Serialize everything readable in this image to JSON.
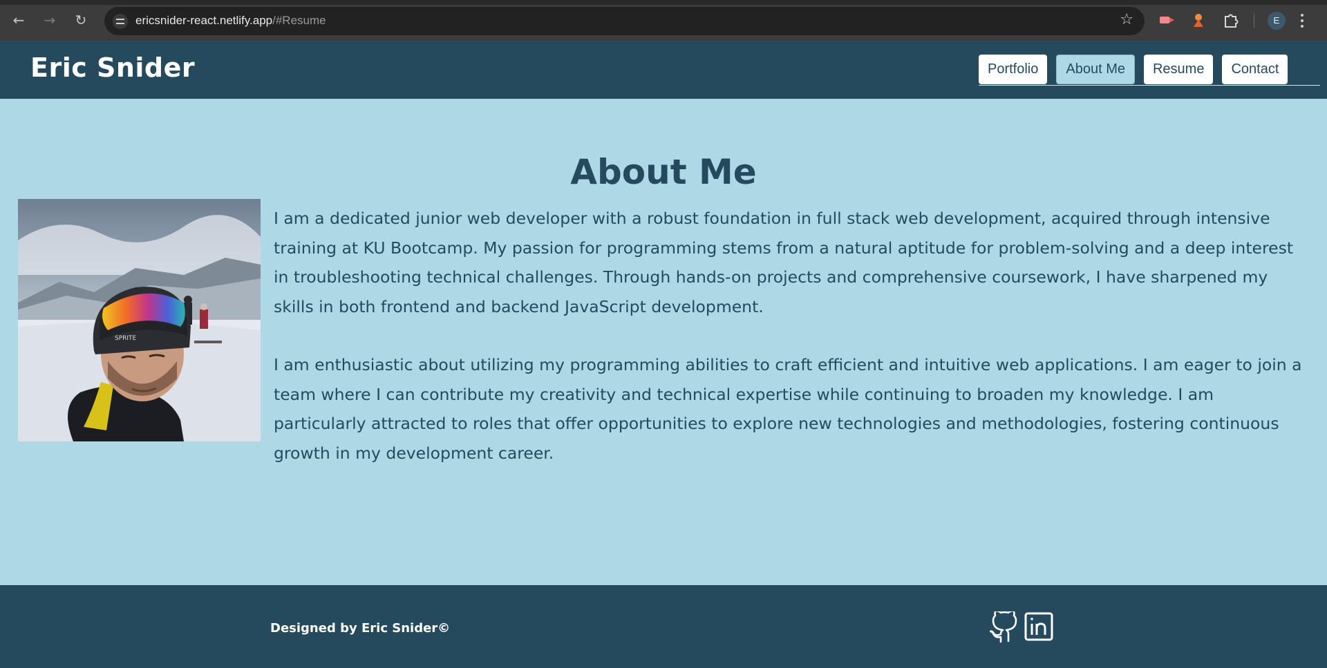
{
  "browser": {
    "url_host": "ericsnider-react.netlify.app",
    "url_path": "/#Resume",
    "profile_initial": "E",
    "icons": [
      "back-icon",
      "forward-icon",
      "reload-icon",
      "site-settings-icon",
      "bookmark-star-icon",
      "extension-icon",
      "extensions-puzzle-icon",
      "profile-avatar",
      "menu-kebab-icon"
    ]
  },
  "header": {
    "title": "Eric Snider",
    "nav": [
      {
        "label": "Portfolio",
        "active": false
      },
      {
        "label": "About Me",
        "active": true
      },
      {
        "label": "Resume",
        "active": false
      },
      {
        "label": "Contact",
        "active": false
      }
    ]
  },
  "about": {
    "heading": "About Me",
    "photo_alt": "Eric Snider skiing selfie",
    "paragraphs": [
      "I am a dedicated junior web developer with a robust foundation in full stack web development, acquired through intensive training at KU Bootcamp. My passion for programming stems from a natural aptitude for problem-solving and a deep interest in troubleshooting technical challenges. Through hands-on projects and comprehensive coursework, I have sharpened my skills in both frontend and backend JavaScript development.",
      "I am enthusiastic about utilizing my programming abilities to craft efficient and intuitive web applications. I am eager to join a team where I can contribute my creativity and technical expertise while continuing to broaden my knowledge. I am particularly attracted to roles that offer opportunities to explore new technologies and methodologies, fostering continuous growth in my development career."
    ]
  },
  "footer": {
    "credit": "Designed by Eric Snider©",
    "social": [
      "github-icon",
      "linkedin-icon"
    ]
  },
  "colors": {
    "header_bg": "#254a5d",
    "page_bg": "#add8e6",
    "text": "#254a5d",
    "nav_bg": "#ffffff"
  }
}
